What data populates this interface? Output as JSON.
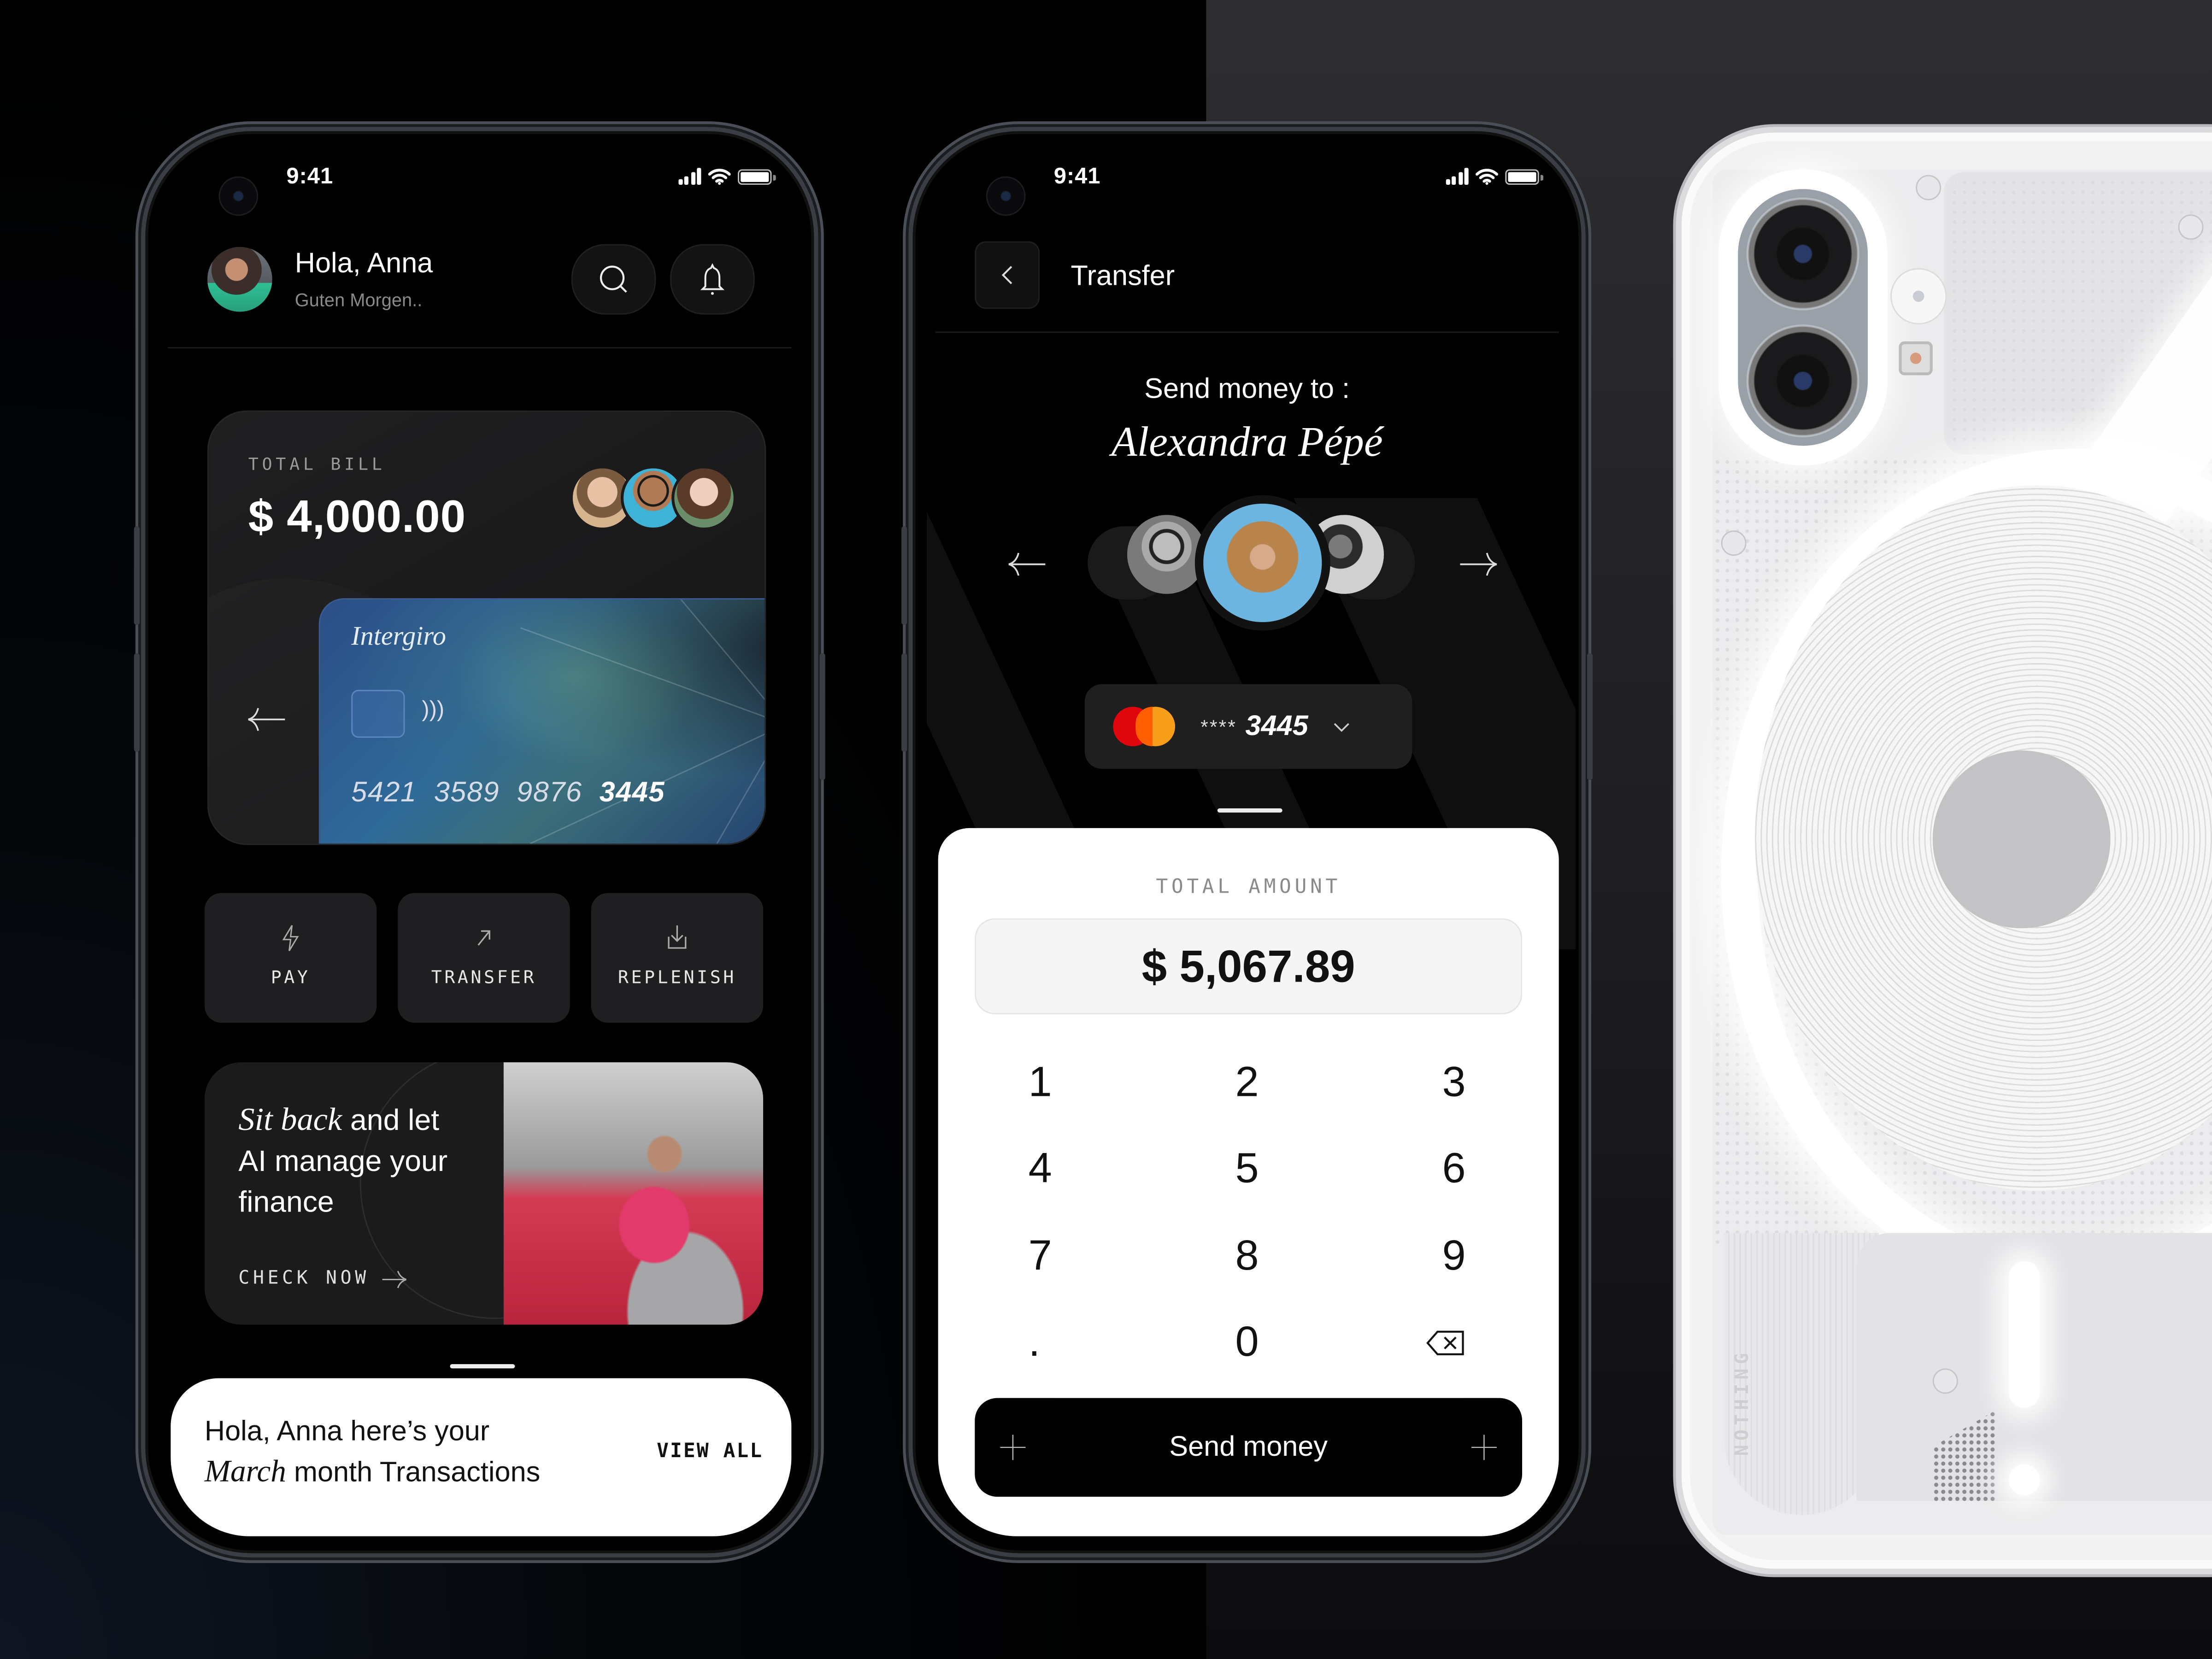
{
  "colors": {
    "background_left": "#000000",
    "background_right": "#2d2d30",
    "card_surface": "#1f1f21",
    "sheet_white": "#ffffff",
    "mastercard_red": "#e0060d",
    "mastercard_orange": "#f79e1b"
  },
  "home_screen": {
    "status_bar": {
      "time": "9:41",
      "icons": [
        "signal-icon",
        "wifi-icon",
        "battery-icon"
      ]
    },
    "header": {
      "greeting": "Hola, Anna",
      "subtitle": "Guten Morgen..",
      "buttons": [
        {
          "icon": "search-icon"
        },
        {
          "icon": "bell-icon"
        }
      ]
    },
    "bill_card": {
      "label": "TOTAL BILL",
      "amount": "$ 4,000.00",
      "participants": 3
    },
    "credit_card": {
      "brand": "Intergiro",
      "number_groups": [
        "5421",
        "3589",
        "9876"
      ],
      "number_last": "3445"
    },
    "actions": [
      {
        "label": "PAY",
        "icon": "lightning-icon"
      },
      {
        "label": "TRANSFER",
        "icon": "arrow-up-right-icon"
      },
      {
        "label": "REPLENISH",
        "icon": "download-icon"
      }
    ],
    "promo": {
      "headline_italic": "Sit back",
      "headline_rest_1": " and let",
      "headline_line_2": "AI manage your",
      "headline_line_3": "finance",
      "cta": "CHECK NOW"
    },
    "transactions_sheet": {
      "line1": "Hola, Anna here’s your",
      "line2_italic": "March",
      "line2_rest": " month Transactions",
      "action": "VIEW ALL"
    }
  },
  "transfer_screen": {
    "status_bar": {
      "time": "9:41",
      "icons": [
        "signal-icon",
        "wifi-icon",
        "battery-icon"
      ]
    },
    "title": "Transfer",
    "send_to_label": "Send money to :",
    "recipient_name": "Alexandra Pépé",
    "payment_card": {
      "masked": "****",
      "last4": "3445",
      "network": "mastercard"
    },
    "amount_label": "TOTAL AMOUNT",
    "amount_value": "$ 5,067.89",
    "keypad": [
      "1",
      "2",
      "3",
      "4",
      "5",
      "6",
      "7",
      "8",
      "9",
      ".",
      "0",
      "⌫"
    ],
    "send_button": "Send money"
  },
  "device_back": {
    "brand_text": "NOTHING"
  }
}
